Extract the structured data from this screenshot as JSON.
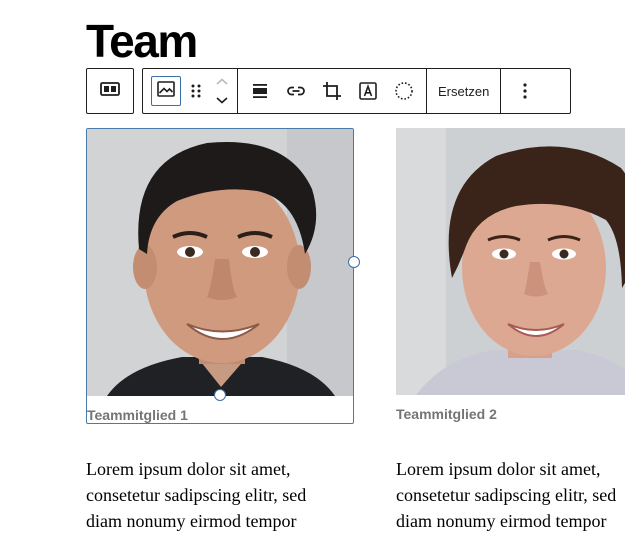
{
  "page": {
    "title": "Team"
  },
  "toolbar": {
    "parent_icon": "columns-icon",
    "image_icon": "image-icon",
    "drag_icon": "drag-handle-icon",
    "move_up_icon": "chevron-up-icon",
    "move_down_icon": "chevron-down-icon",
    "align_icon": "align-wide-icon",
    "link_icon": "link-icon",
    "crop_icon": "crop-icon",
    "text_overlay_icon": "text-overlay-icon",
    "duotone_icon": "dotted-circle-icon",
    "replace_label": "Ersetzen",
    "more_icon": "more-vertical-icon"
  },
  "members": [
    {
      "caption": "Teammitglied 1",
      "bio": "Lorem ipsum dolor sit amet,\nconsetetur sadipscing elitr, sed\ndiam nonumy eirmod tempor"
    },
    {
      "caption": "Teammitglied 2",
      "bio": "Lorem ipsum dolor sit amet,\nconsetetur sadipscing elitr, sed\ndiam nonumy eirmod tempor"
    }
  ],
  "colors": {
    "selection": "#3a6fa8",
    "caption": "#757575",
    "toolbar_border": "#1e1e1e"
  }
}
